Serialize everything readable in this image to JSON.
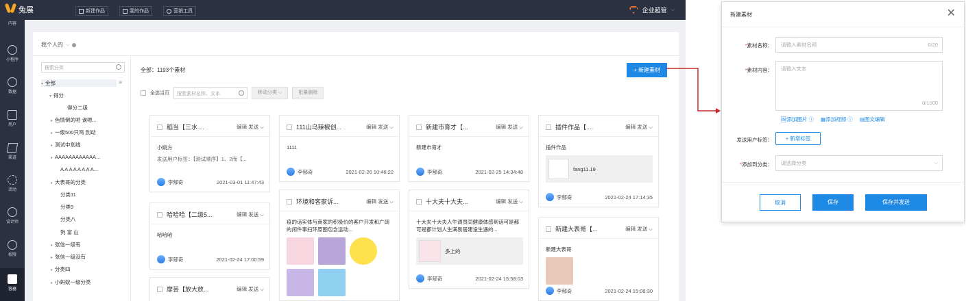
{
  "app": {
    "logo_text": "兔展"
  },
  "topnav": [
    {
      "label": "新建作品",
      "icon": "plus-square-icon"
    },
    {
      "label": "我的作品",
      "icon": "folder-icon"
    },
    {
      "label": "营销工具",
      "icon": "gear-icon"
    }
  ],
  "enterprise": {
    "label": "企业超管"
  },
  "sidebar": [
    {
      "label": "内容",
      "icon": "content-icon"
    },
    {
      "label": "小程序",
      "icon": "miniapp-icon"
    },
    {
      "label": "数据",
      "icon": "pie-chart-icon"
    },
    {
      "label": "用户",
      "icon": "user-card-icon"
    },
    {
      "label": "渠道",
      "icon": "paper-plane-icon"
    },
    {
      "label": "活动",
      "icon": "refresh-icon"
    },
    {
      "label": "设计师",
      "icon": "scissors-icon"
    },
    {
      "label": "权限",
      "icon": "person-icon"
    },
    {
      "label": "容器",
      "icon": "folder-icon",
      "active": true
    }
  ],
  "breadcrumb": "我个人的",
  "tree": {
    "search_placeholder": "搜索分类",
    "nodes": [
      "全部",
      "得分",
      "得分二级",
      "色情倒的吧 诶嗯...",
      "一级500只鸡 刮动",
      "测试中划线",
      "AAAAAAAAAAAA...",
      "A A A A A A A A...",
      "大表哥的分类",
      "分类11",
      "分类9",
      "分类八",
      "狗 富 山",
      "张信一级有",
      "张信一级没有",
      "分类四",
      "小蚂蚁一级分类"
    ]
  },
  "main": {
    "count": "全部：1193个素材",
    "new_button": "+ 新建素材",
    "select_all": "全选当页",
    "search_placeholder": "搜索素材名称、文本",
    "move_button": "移动分类 ⌵",
    "batch_delete": "批量删除"
  },
  "cards": [
    {
      "title": "稻当【三水 ...",
      "ops": "编辑 发送 ⌵",
      "body": "小姚方",
      "sub": "发送用户标签：【测试顺序】1、2而【...",
      "user": "李郁奇",
      "time": "2021-03-01 11:47:43"
    },
    {
      "title": "哈哈哈【二级5...",
      "ops": "编辑 发送 ⌵",
      "body": "哈哈哈",
      "user": "李郁奇",
      "time": "2021-02-24 17:00:59"
    },
    {
      "title": "摩芸【放大放...",
      "ops": "编辑 发送 ⌵"
    },
    {
      "title": "111山乌辣椒创...",
      "ops": "编辑 发送 ⌵",
      "body": "1111",
      "user": "李郁奇",
      "time": "2021-02-26 10:46:22"
    },
    {
      "title": "环境和客家诉...",
      "ops": "编辑 发送 ⌵",
      "body": "疫的话实体与商家的积极价的客户开发和广阔的闲件事扫环原图包含运动...",
      "user": "",
      "time": ""
    },
    {
      "title": "新建市育才【...",
      "ops": "编辑 发送 ⌵",
      "body": "新建市育才",
      "user": "李郁奇",
      "time": "2021-02-25 14:34:48"
    },
    {
      "title": "十大夫十大夫...",
      "ops": "编辑 发送 ⌵",
      "body": "十大夫十大夫人牛调员同健康体感到话可是都可是都计划人生满易居建设生遇的...",
      "mini_label": "多上的",
      "user": "李郁奇",
      "time": "2021-02-24 15:58:03"
    },
    {
      "title": "插件作品【....",
      "ops": "编辑 发送 ⌵",
      "body": "插件作品",
      "mini_label": "fang11.19",
      "user": "李郁奇",
      "time": "2021-02-24 17:14:35"
    },
    {
      "title": "新建大表哥【...",
      "ops": "编辑 发送 ⌵",
      "body": "新建大表哥",
      "user": "李郁奇",
      "time": "2021-02-24 15:08:30"
    }
  ],
  "dialog": {
    "title": "新建素材",
    "name_label": "素材名称：",
    "name_placeholder": "请输入素材名称",
    "name_count": "0/20",
    "content_label": "素材内容：",
    "content_placeholder": "请输入文本",
    "content_count": "0/1000",
    "add_image": "添加图片",
    "add_video": "添加视频",
    "add_article": "图文编辑",
    "tag_label": "发送用户标签：",
    "add_tag": "+ 新增标签",
    "category_label": "添加到分类：",
    "category_placeholder": "请选择分类",
    "cancel": "取消",
    "save": "保存",
    "save_send": "保存并发送"
  },
  "colors": {
    "accent": "#1e88e5",
    "arrow": "#c62828",
    "topbar": "#2b3140"
  }
}
